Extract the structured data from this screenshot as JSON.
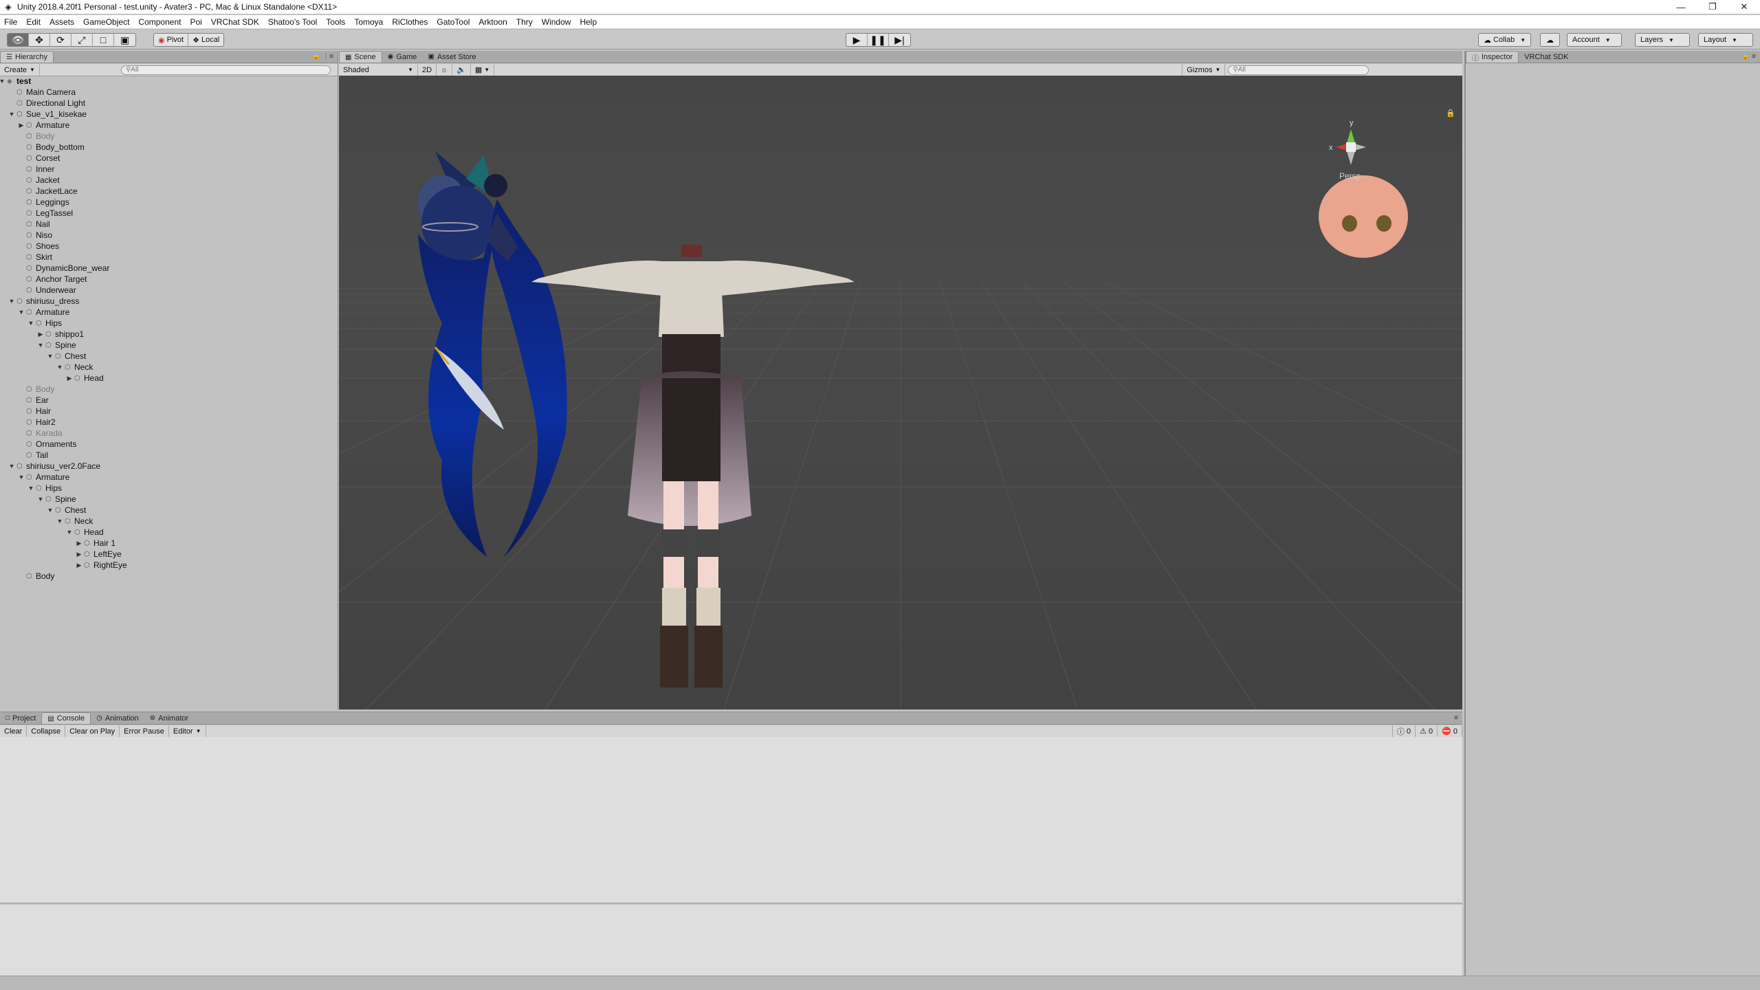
{
  "window": {
    "title": "Unity 2018.4.20f1 Personal - test.unity - Avater3 - PC, Mac & Linux Standalone <DX11>",
    "controls": [
      "minimize",
      "restore",
      "close"
    ]
  },
  "menu": [
    "File",
    "Edit",
    "Assets",
    "GameObject",
    "Component",
    "Poi",
    "VRChat SDK",
    "Shatoo's Tool",
    "Tools",
    "Tomoya",
    "RiClothes",
    "GatoTool",
    "Arktoon",
    "Thry",
    "Window",
    "Help"
  ],
  "toolbar": {
    "tools": [
      "hand-tool",
      "move-tool",
      "rotate-tool",
      "scale-tool",
      "rect-tool",
      "transform-tool"
    ],
    "pivot": "Pivot",
    "local": "Local",
    "play_controls": [
      "play",
      "pause",
      "step"
    ],
    "collab": "Collab",
    "account": "Account",
    "layers": "Layers",
    "layout": "Layout"
  },
  "hierarchy": {
    "tab": "Hierarchy",
    "create": "Create",
    "search_placeholder": "All",
    "items": [
      {
        "label": "test",
        "depth": 0,
        "arrow": "expanded",
        "scene": true
      },
      {
        "label": "Main Camera",
        "depth": 1,
        "arrow": "none"
      },
      {
        "label": "Directional Light",
        "depth": 1,
        "arrow": "none"
      },
      {
        "label": "Sue_v1_kisekae",
        "depth": 1,
        "arrow": "expanded"
      },
      {
        "label": "Armature",
        "depth": 2,
        "arrow": "collapsed"
      },
      {
        "label": "Body",
        "depth": 2,
        "arrow": "none",
        "dim": true
      },
      {
        "label": "Body_bottom",
        "depth": 2,
        "arrow": "none"
      },
      {
        "label": "Corset",
        "depth": 2,
        "arrow": "none"
      },
      {
        "label": "Inner",
        "depth": 2,
        "arrow": "none"
      },
      {
        "label": "Jacket",
        "depth": 2,
        "arrow": "none"
      },
      {
        "label": "JacketLace",
        "depth": 2,
        "arrow": "none"
      },
      {
        "label": "Leggings",
        "depth": 2,
        "arrow": "none"
      },
      {
        "label": "LegTassel",
        "depth": 2,
        "arrow": "none"
      },
      {
        "label": "Nail",
        "depth": 2,
        "arrow": "none"
      },
      {
        "label": "Niso",
        "depth": 2,
        "arrow": "none"
      },
      {
        "label": "Shoes",
        "depth": 2,
        "arrow": "none"
      },
      {
        "label": "Skirt",
        "depth": 2,
        "arrow": "none"
      },
      {
        "label": "DynamicBone_wear",
        "depth": 2,
        "arrow": "none"
      },
      {
        "label": "Anchor Target",
        "depth": 2,
        "arrow": "none"
      },
      {
        "label": "Underwear",
        "depth": 2,
        "arrow": "none"
      },
      {
        "label": "shiriusu_dress",
        "depth": 1,
        "arrow": "expanded"
      },
      {
        "label": "Armature",
        "depth": 2,
        "arrow": "expanded"
      },
      {
        "label": "Hips",
        "depth": 3,
        "arrow": "expanded"
      },
      {
        "label": "shippo1",
        "depth": 4,
        "arrow": "collapsed"
      },
      {
        "label": "Spine",
        "depth": 4,
        "arrow": "expanded"
      },
      {
        "label": "Chest",
        "depth": 5,
        "arrow": "expanded"
      },
      {
        "label": "Neck",
        "depth": 6,
        "arrow": "expanded"
      },
      {
        "label": "Head",
        "depth": 7,
        "arrow": "collapsed"
      },
      {
        "label": "Body",
        "depth": 2,
        "arrow": "none",
        "dim": true
      },
      {
        "label": "Ear",
        "depth": 2,
        "arrow": "none"
      },
      {
        "label": "Hair",
        "depth": 2,
        "arrow": "none"
      },
      {
        "label": "Hair2",
        "depth": 2,
        "arrow": "none"
      },
      {
        "label": "Karada",
        "depth": 2,
        "arrow": "none",
        "dim": true
      },
      {
        "label": "Ornaments",
        "depth": 2,
        "arrow": "none"
      },
      {
        "label": "Tail",
        "depth": 2,
        "arrow": "none"
      },
      {
        "label": "shiriusu_ver2.0Face",
        "depth": 1,
        "arrow": "expanded"
      },
      {
        "label": "Armature",
        "depth": 2,
        "arrow": "expanded"
      },
      {
        "label": "Hips",
        "depth": 3,
        "arrow": "expanded"
      },
      {
        "label": "Spine",
        "depth": 4,
        "arrow": "expanded"
      },
      {
        "label": "Chest",
        "depth": 5,
        "arrow": "expanded"
      },
      {
        "label": "Neck",
        "depth": 6,
        "arrow": "expanded"
      },
      {
        "label": "Head",
        "depth": 7,
        "arrow": "expanded"
      },
      {
        "label": "Hair 1",
        "depth": 8,
        "arrow": "collapsed"
      },
      {
        "label": "LeftEye",
        "depth": 8,
        "arrow": "collapsed"
      },
      {
        "label": "RightEye",
        "depth": 8,
        "arrow": "collapsed"
      },
      {
        "label": "Body",
        "depth": 2,
        "arrow": "none"
      }
    ]
  },
  "scene": {
    "tabs": [
      "Scene",
      "Game",
      "Asset Store"
    ],
    "active_tab": "Scene",
    "shading": "Shaded",
    "mode_2d": "2D",
    "gizmos": "Gizmos",
    "search_placeholder": "All",
    "gizmo_label": "Persp",
    "axis_y": "y",
    "axis_x": "x",
    "background": "#474747"
  },
  "inspector": {
    "tabs": [
      "Inspector",
      "VRChat SDK"
    ],
    "active_tab": "Inspector"
  },
  "console": {
    "tabs": [
      "Project",
      "Console",
      "Animation",
      "Animator"
    ],
    "active_tab": "Console",
    "buttons": [
      "Clear",
      "Collapse",
      "Clear on Play",
      "Error Pause",
      "Editor"
    ],
    "counts": {
      "info": "0",
      "warning": "0",
      "error": "0"
    }
  }
}
